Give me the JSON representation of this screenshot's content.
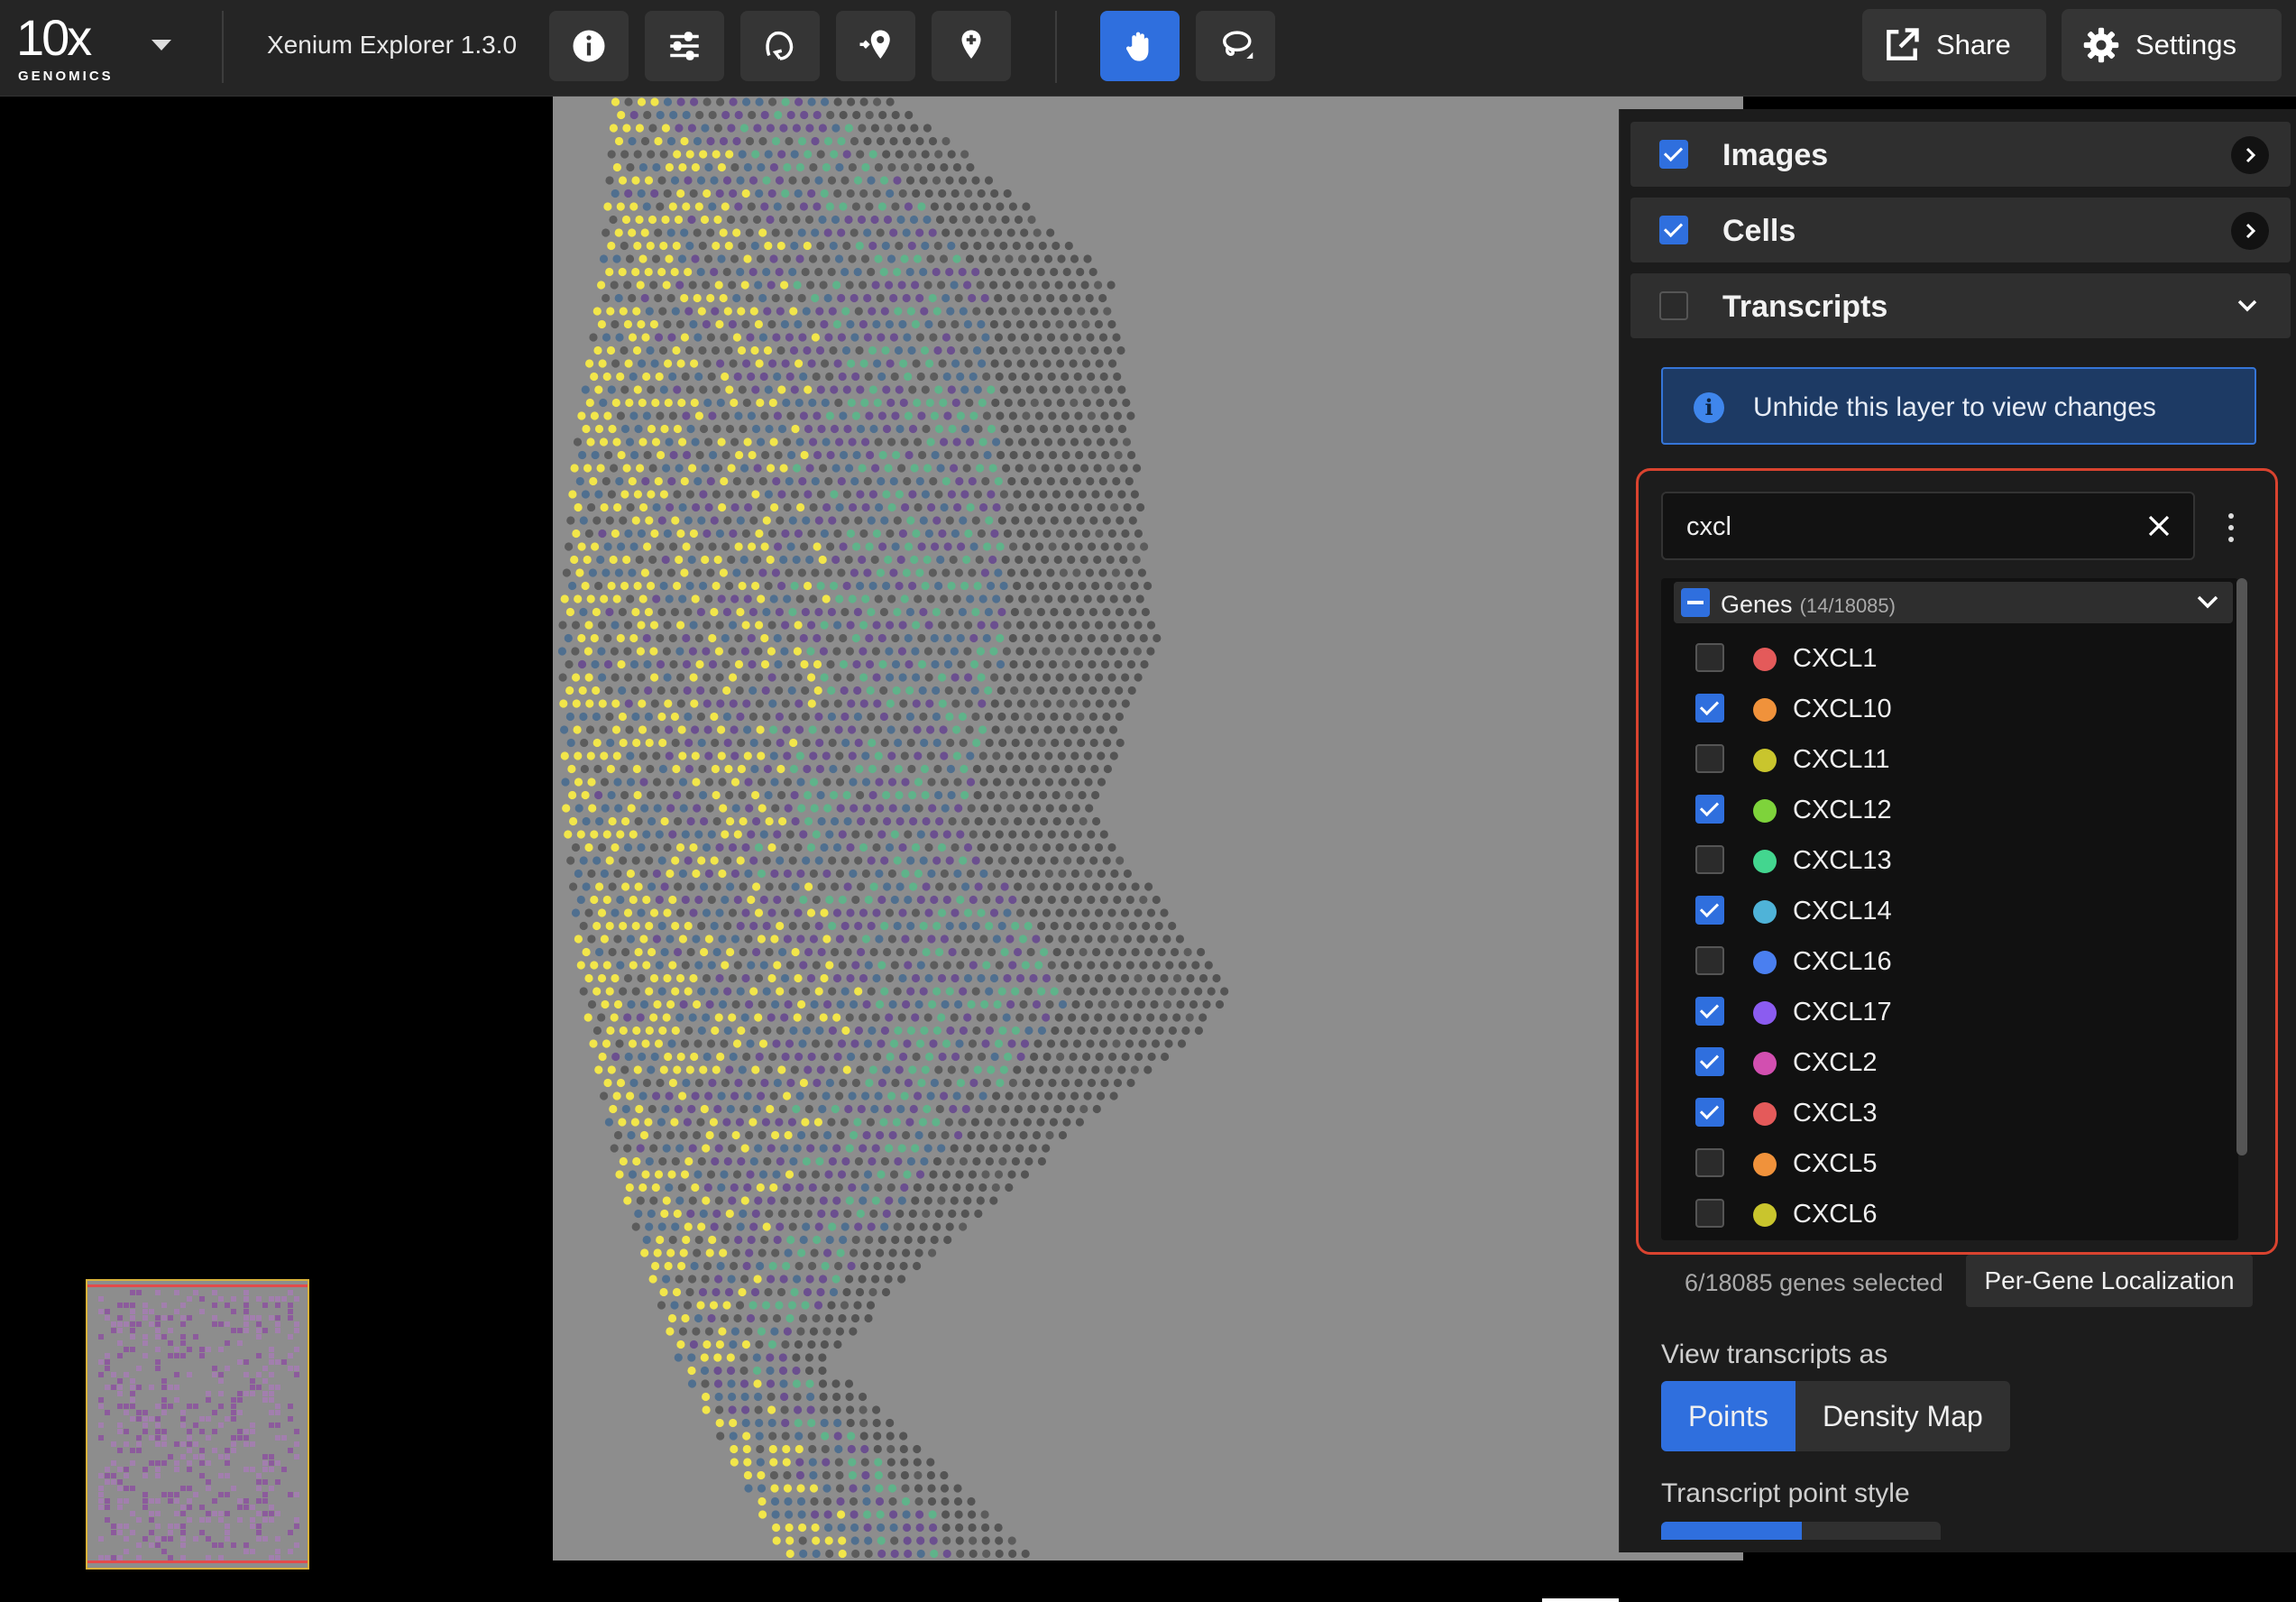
{
  "header": {
    "logo_text": "10x",
    "logo_subtext": "GENOMICS",
    "app_title": "Xenium Explorer 1.3.0",
    "share_label": "Share",
    "settings_label": "Settings"
  },
  "toolbar_icons": [
    "info-icon",
    "sliders-icon",
    "hand-lasso-icon",
    "add-location-icon",
    "add-pin-icon",
    "hand-pan-icon",
    "lasso-icon"
  ],
  "layers": {
    "images": {
      "label": "Images",
      "checked": true
    },
    "cells": {
      "label": "Cells",
      "checked": true
    },
    "transcripts": {
      "label": "Transcripts",
      "checked": false
    }
  },
  "info_message": "Unhide this layer to view changes",
  "search": {
    "value": "cxcl"
  },
  "genes_group": {
    "label": "Genes",
    "count": "(14/18085)"
  },
  "genes": [
    {
      "name": "CXCL1",
      "checked": false,
      "color": "#e45a5a"
    },
    {
      "name": "CXCL10",
      "checked": true,
      "color": "#f0923b"
    },
    {
      "name": "CXCL11",
      "checked": false,
      "color": "#c9c52d"
    },
    {
      "name": "CXCL12",
      "checked": true,
      "color": "#7ed33b"
    },
    {
      "name": "CXCL13",
      "checked": false,
      "color": "#43d68f"
    },
    {
      "name": "CXCL14",
      "checked": true,
      "color": "#4fb3d8"
    },
    {
      "name": "CXCL16",
      "checked": false,
      "color": "#4a7ff0"
    },
    {
      "name": "CXCL17",
      "checked": true,
      "color": "#8b5cf0"
    },
    {
      "name": "CXCL2",
      "checked": true,
      "color": "#d24fb0"
    },
    {
      "name": "CXCL3",
      "checked": true,
      "color": "#e45a5a"
    },
    {
      "name": "CXCL5",
      "checked": false,
      "color": "#f0923b"
    },
    {
      "name": "CXCL6",
      "checked": false,
      "color": "#c9c52d"
    }
  ],
  "selection_text": "6/18085 genes selected",
  "per_gene_button": "Per-Gene Localization",
  "view_as": {
    "label": "View transcripts as",
    "options": [
      "Points",
      "Density Map"
    ],
    "selected": "Points"
  },
  "point_style_label": "Transcript point style",
  "colors": {
    "accent": "#2f6fde",
    "highlight_box": "#d9432f",
    "panel_bg": "#1c1c1c"
  }
}
